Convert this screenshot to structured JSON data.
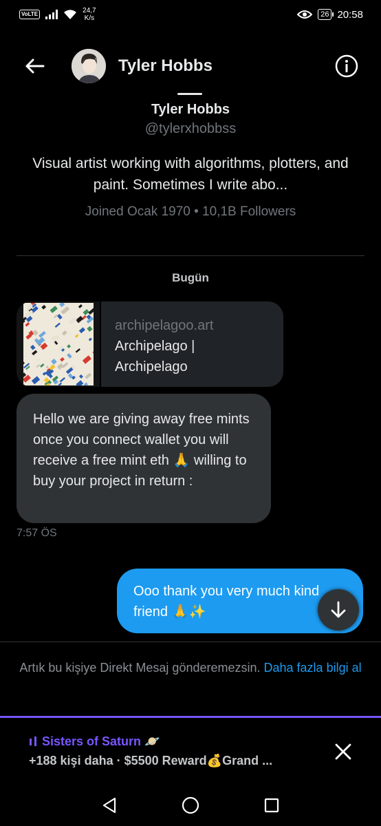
{
  "status_bar": {
    "volte": "VoLTE",
    "speed_value": "24,7",
    "speed_unit": "K/s",
    "battery": "26",
    "time": "20:58"
  },
  "header": {
    "name": "Tyler Hobbs"
  },
  "profile": {
    "name": "Tyler Hobbs",
    "handle": "@tylerxhobbss",
    "bio": "Visual artist working with algorithms, plotters, and paint. Sometimes I write abo...",
    "meta": "Joined Ocak 1970 • 10,1B Followers"
  },
  "conversation": {
    "day_label": "Bugün",
    "link_card": {
      "domain": "archipelagoo.art",
      "title_line1": "Archipelago |",
      "title_line2": "Archipelago"
    },
    "received_message": {
      "text": "Hello we are giving away free mints once you connect wallet you will receive a free mint eth 🙏 willing to buy your project in return :",
      "time": "7:57 ÖS"
    },
    "sent_message": {
      "text": "Ooo thank you very much kind friend 🙏✨"
    }
  },
  "notice": {
    "text": "Artık bu kişiye Direkt Mesaj gönderemezsin. ",
    "link": "Daha fazla bilgi al"
  },
  "spaces": {
    "title": "Sisters of Saturn 🪐",
    "subtitle": "+188 kişi daha · $5500 Reward💰Grand ..."
  },
  "colors": {
    "accent_blue": "#1d9bf0",
    "spaces_purple": "#7856ff",
    "bubble_gray": "#2f3336"
  }
}
